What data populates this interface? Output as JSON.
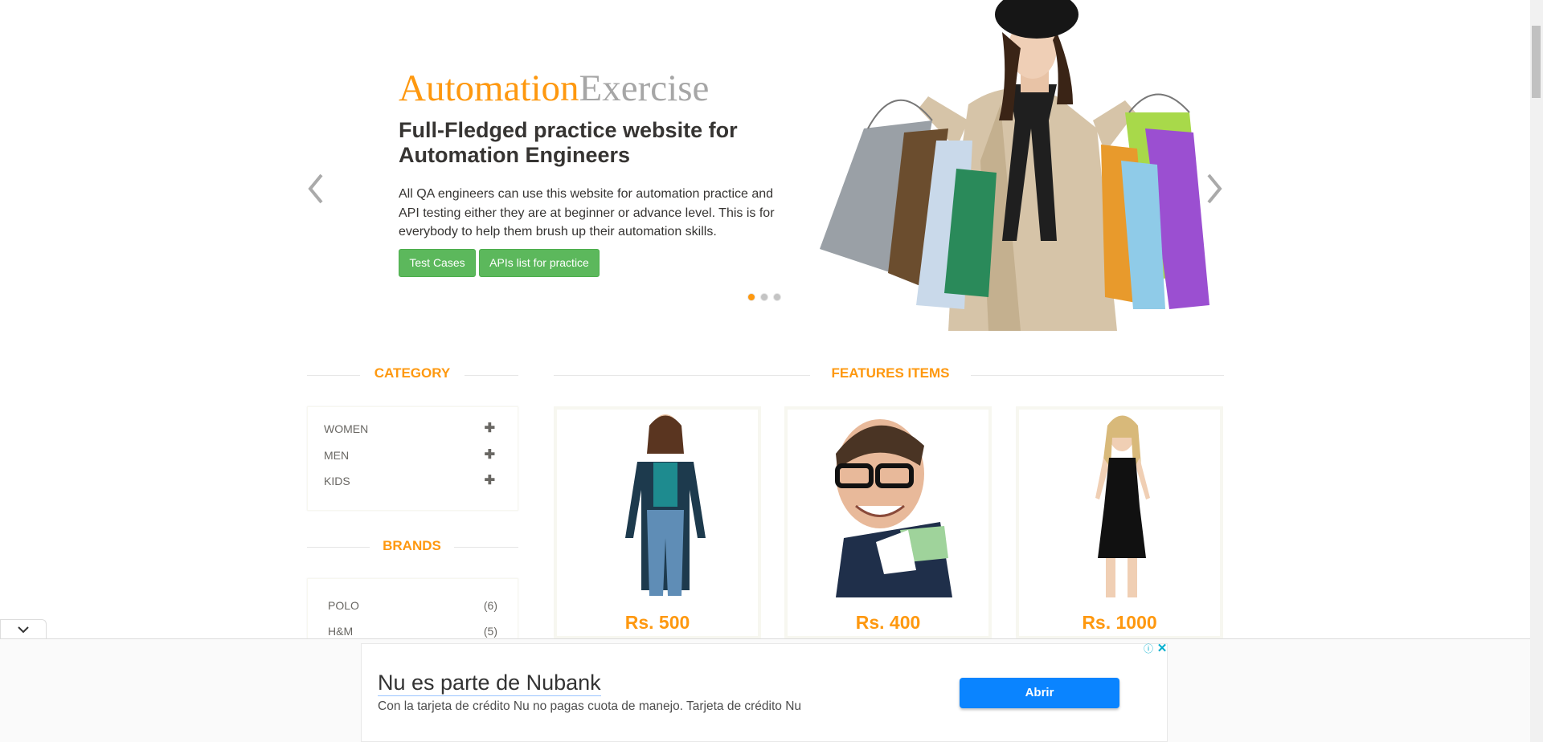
{
  "hero": {
    "brand_part1": "Automation",
    "brand_part2": "Exercise",
    "heading": "Full-Fledged practice website for Automation Engineers",
    "description": "All QA engineers can use this website for automation practice and API testing either they are at beginner or advance level. This is for everybody to help them brush up their automation skills.",
    "btn_test_cases": "Test Cases",
    "btn_apis": "APIs list for practice",
    "active_slide": 1,
    "slide_count": 3
  },
  "sidebar": {
    "category_title": "CATEGORY",
    "categories": [
      {
        "label": "WOMEN",
        "icon": "plus-icon"
      },
      {
        "label": "MEN",
        "icon": "plus-icon"
      },
      {
        "label": "KIDS",
        "icon": "plus-icon"
      }
    ],
    "brands_title": "BRANDS",
    "brands": [
      {
        "label": "POLO",
        "count": "(6)"
      },
      {
        "label": "H&M",
        "count": "(5)"
      }
    ]
  },
  "features": {
    "title": "FEATURES ITEMS",
    "products": [
      {
        "price": "Rs. 500",
        "image": "woman-in-cardigan"
      },
      {
        "price": "Rs. 400",
        "image": "man-with-glasses"
      },
      {
        "price": "Rs. 1000",
        "image": "woman-black-dress"
      }
    ]
  },
  "ad": {
    "title": "Nu es parte de Nubank",
    "text": "Con la tarjeta de crédito Nu no pagas cuota de manejo. Tarjeta de crédito Nu",
    "button": "Abrir",
    "info_icon": "ⓘ",
    "close_icon": "✕"
  },
  "colors": {
    "accent": "#FE980F",
    "button_green": "#5cb85c",
    "ad_button": "#0a84ff"
  }
}
